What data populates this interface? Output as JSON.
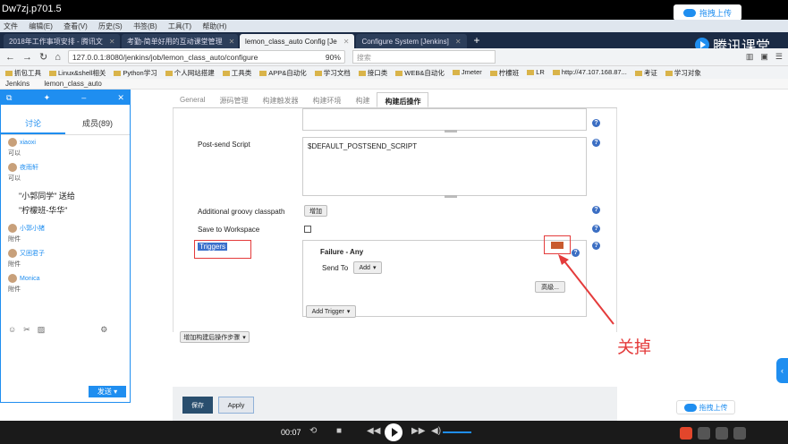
{
  "video": {
    "title": "Dw7zj.p701.5",
    "upload_label": "拖拽上传"
  },
  "menu": [
    "文件",
    "编辑(E)",
    "查看(V)",
    "历史(S)",
    "书签(B)",
    "工具(T)",
    "帮助(H)"
  ],
  "tabs": [
    {
      "label": "2018年工作事项安排 - 腾讯文",
      "active": false
    },
    {
      "label": "考勤-简单好用的互动课堂管理",
      "active": false
    },
    {
      "label": "lemon_class_auto Config [Je",
      "active": true
    },
    {
      "label": "Configure System [Jenkins]",
      "active": false
    }
  ],
  "brand": "腾讯课堂",
  "nav": {
    "url": "127.0.0.1:8080/jenkins/job/lemon_class_auto/configure",
    "zoom": "90%",
    "search_placeholder": "搜索"
  },
  "bookmarks": [
    "抓包工具",
    "Linux&shell相关",
    "Python学习",
    "个人网站搭建",
    "工具类",
    "APP&自动化",
    "学习文档",
    "接口类",
    "WEB&自动化",
    "Jmeter",
    "柠檬班",
    "LR",
    "http://47.107.168.87...",
    "考证",
    "学习对象"
  ],
  "breadcrumbs": [
    "Jenkins",
    "lemon_class_auto"
  ],
  "chat": {
    "tab_discuss": "讨论",
    "tab_members": "成员(89)",
    "messages": [
      {
        "user": "xiaoxi",
        "text": "可以"
      },
      {
        "user": "夜雨轩",
        "text": "可以"
      }
    ],
    "gift_line1": "\"小郭同学\" 送给",
    "gift_line2": "\"柠檬班-华华\"",
    "messages2": [
      {
        "user": "小郭小猪",
        "text": "附件"
      },
      {
        "user": "又困君子",
        "text": "附件"
      },
      {
        "user": "Monica",
        "text": "附件"
      }
    ],
    "send_label": "发送"
  },
  "jenkins": {
    "tabs": [
      "General",
      "源码管理",
      "构建触发器",
      "构建环境",
      "构建",
      "构建后操作"
    ],
    "post_send_label": "Post-send Script",
    "post_send_value": "$DEFAULT_POSTSEND_SCRIPT",
    "groovy_label": "Additional groovy classpath",
    "groovy_button": "增加",
    "save_workspace_label": "Save to Workspace",
    "triggers_label": "Triggers",
    "trigger_title": "Failure - Any",
    "send_to_label": "Send To",
    "add_button": "Add",
    "advanced_button": "高级...",
    "add_trigger_button": "Add Trigger",
    "add_post_build_button": "增加构建后操作步骤",
    "save_button": "保存",
    "apply_button": "Apply",
    "annotation": "关掉"
  },
  "player": {
    "time": "00:07"
  }
}
